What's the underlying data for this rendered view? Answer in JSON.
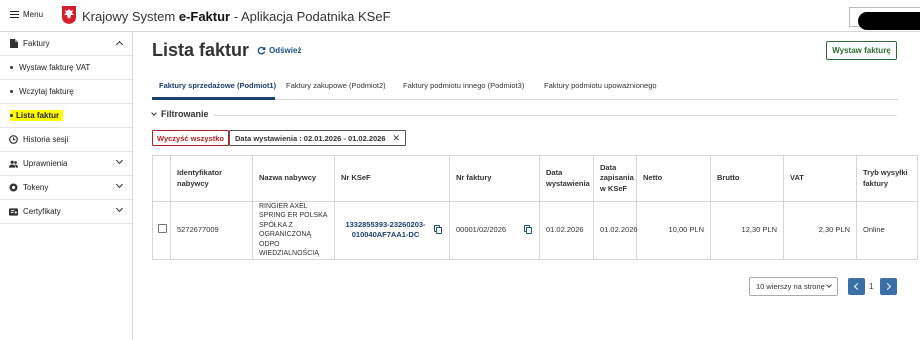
{
  "header": {
    "menu_label": "Menu",
    "title_prefix": "Krajowy System ",
    "title_brand": "e-Faktur",
    "title_suffix": " - Aplikacja Podatnika KSeF"
  },
  "sidebar": {
    "items": [
      {
        "label": "Faktury",
        "icon": "document-icon"
      },
      {
        "label": "Wystaw fakturę VAT"
      },
      {
        "label": "Wczytaj fakturę"
      },
      {
        "label": "Lista faktur"
      },
      {
        "label": "Historia sesji",
        "icon": "clock-icon"
      },
      {
        "label": "Uprawnienia",
        "icon": "users-icon"
      },
      {
        "label": "Tokeny",
        "icon": "token-icon"
      },
      {
        "label": "Certyfikaty",
        "icon": "certificate-icon"
      }
    ]
  },
  "main": {
    "page_title": "Lista faktur",
    "refresh_label": "Odśwież",
    "issue_button_label": "Wystaw fakturę",
    "tabs": [
      {
        "label": "Faktury sprzedażowe (Podmiot1)"
      },
      {
        "label": "Faktury zakupowe (Podmiot2)"
      },
      {
        "label": "Faktury podmiotu innego (Podmiot3)"
      },
      {
        "label": "Faktury podmiotu upoważnionego"
      }
    ],
    "filter_heading": "Filtrowanie",
    "clear_all_label": "Wyczyść wszystko",
    "filter_chip": "Data wystawienia : 02.01.2026 - 01.02.2026"
  },
  "table": {
    "columns": [
      "Identyfikator nabywcy",
      "Nazwa nabywcy",
      "Nr KSeF",
      "Nr faktury",
      "Data wystawienia",
      "Data zapisania w KSeF",
      "Netto",
      "Brutto",
      "VAT",
      "Tryb wysyłki faktury"
    ],
    "rows": [
      {
        "buyer_id": "5272677009",
        "buyer_name": "RINGIER AXEL SPRING ER POLSKA SPÓŁKA Z OGRANICZONĄ ODPO WIEDZIALNOŚCIĄ",
        "ksef_no": "1332855393-23260203-010040AF7AA1-DC",
        "invoice_no": "00001/02/2026",
        "issue_date": "01.02.2026",
        "saved_date": "01.02.2026",
        "net": "10,00 PLN",
        "gross": "12,30 PLN",
        "vat": "2,30 PLN",
        "mode": "Online"
      }
    ]
  },
  "pagination": {
    "per_page_label": "10 wierszy na stronę",
    "current_page": "1"
  },
  "colors": {
    "accent": "#1b3f73",
    "primary_green": "#2d6a36",
    "danger": "#b32020",
    "highlight": "#ffff00",
    "pager_blue": "#3b6fa8"
  }
}
